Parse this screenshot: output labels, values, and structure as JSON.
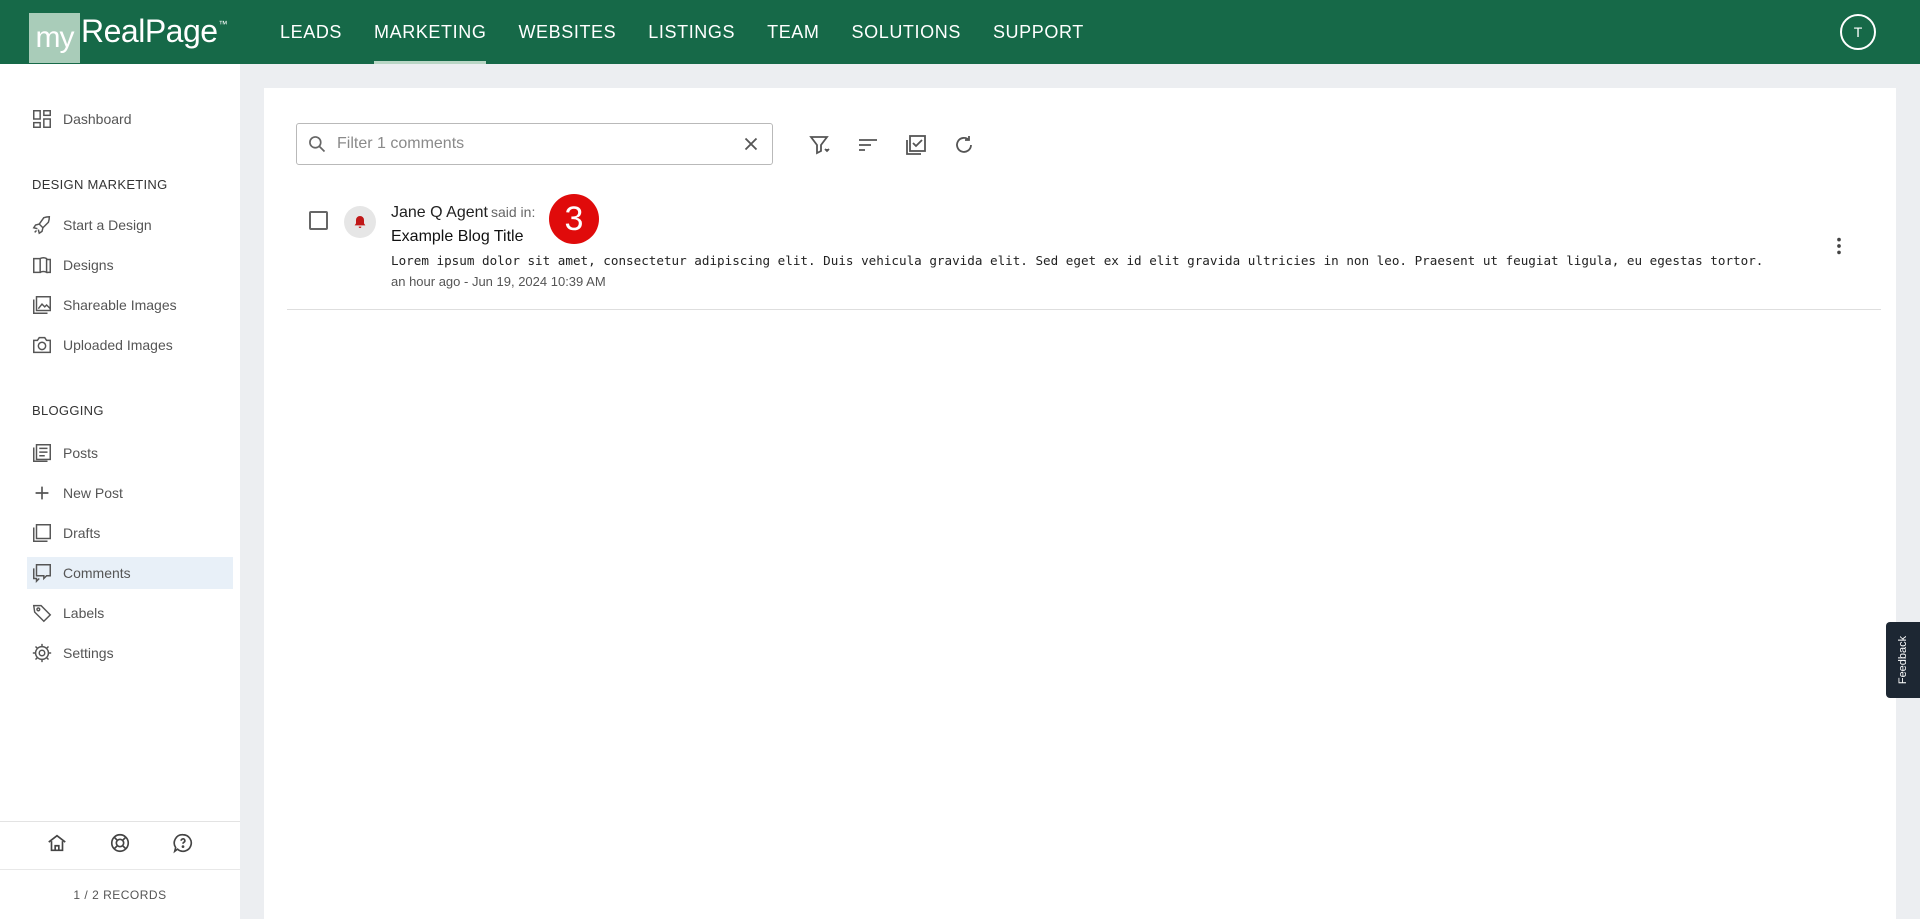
{
  "brand": {
    "my": "my",
    "name": "RealPage",
    "tm": "™"
  },
  "nav": {
    "items": [
      {
        "label": "LEADS"
      },
      {
        "label": "MARKETING"
      },
      {
        "label": "WEBSITES"
      },
      {
        "label": "LISTINGS"
      },
      {
        "label": "TEAM"
      },
      {
        "label": "SOLUTIONS"
      },
      {
        "label": "SUPPORT"
      }
    ],
    "active": "MARKETING",
    "user_initial": "T"
  },
  "sidebar": {
    "dashboard": "Dashboard",
    "design_heading": "DESIGN MARKETING",
    "design_items": [
      "Start a Design",
      "Designs",
      "Shareable Images",
      "Uploaded Images"
    ],
    "blog_heading": "BLOGGING",
    "blog_items": [
      "Posts",
      "New Post",
      "Drafts",
      "Comments",
      "Labels",
      "Settings"
    ],
    "active_item": "Comments",
    "records": "1 / 2 RECORDS"
  },
  "search": {
    "placeholder": "Filter 1 comments",
    "value": ""
  },
  "comment": {
    "author": "Jane Q Agent",
    "said_in": "said in:",
    "badge": "3",
    "post_title": "Example Blog Title",
    "body": "Lorem ipsum dolor sit amet, consectetur adipiscing elit. Duis vehicula gravida elit. Sed eget ex id elit gravida ultricies in non leo. Praesent ut feugiat ligula, eu egestas tortor.",
    "meta": "an hour ago - Jun 19, 2024 10:39 AM"
  },
  "feedback_label": "Feedback",
  "colors": {
    "brand_green": "#166948",
    "badge_red": "#e00b0b",
    "active_bg": "#e8f0f8"
  }
}
